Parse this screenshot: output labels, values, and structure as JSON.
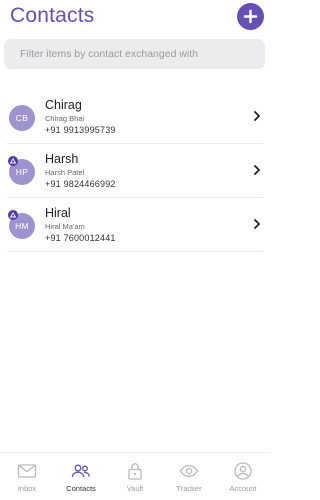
{
  "header": {
    "title": "Contacts",
    "add_icon": "plus-icon"
  },
  "search": {
    "placeholder": "Filter items by contact exchanged with"
  },
  "contacts": [
    {
      "initials": "CB",
      "name": "Chirag",
      "subtitle": "Chirag Bhai",
      "phone": "+91 9913995739",
      "badge": false
    },
    {
      "initials": "HP",
      "name": "Harsh",
      "subtitle": "Harsh Patel",
      "phone": "+91 9824466992",
      "badge": true
    },
    {
      "initials": "HM",
      "name": "Hiral",
      "subtitle": "Hiral Ma'am",
      "phone": "+91 7600012441",
      "badge": true
    }
  ],
  "tabs": [
    {
      "label": "Inbox",
      "icon": "mail-icon",
      "active": false
    },
    {
      "label": "Contacts",
      "icon": "people-icon",
      "active": true
    },
    {
      "label": "Vault",
      "icon": "lock-icon",
      "active": false
    },
    {
      "label": "Tracker",
      "icon": "eye-icon",
      "active": false
    },
    {
      "label": "Account",
      "icon": "user-circle-icon",
      "active": false
    }
  ],
  "colors": {
    "accent": "#6650b4",
    "avatar": "#9e93cf",
    "badge": "#4f3aa7",
    "search_bg": "#ececee",
    "active_icon": "#6650b4",
    "inactive_icon": "#b9b9be"
  }
}
